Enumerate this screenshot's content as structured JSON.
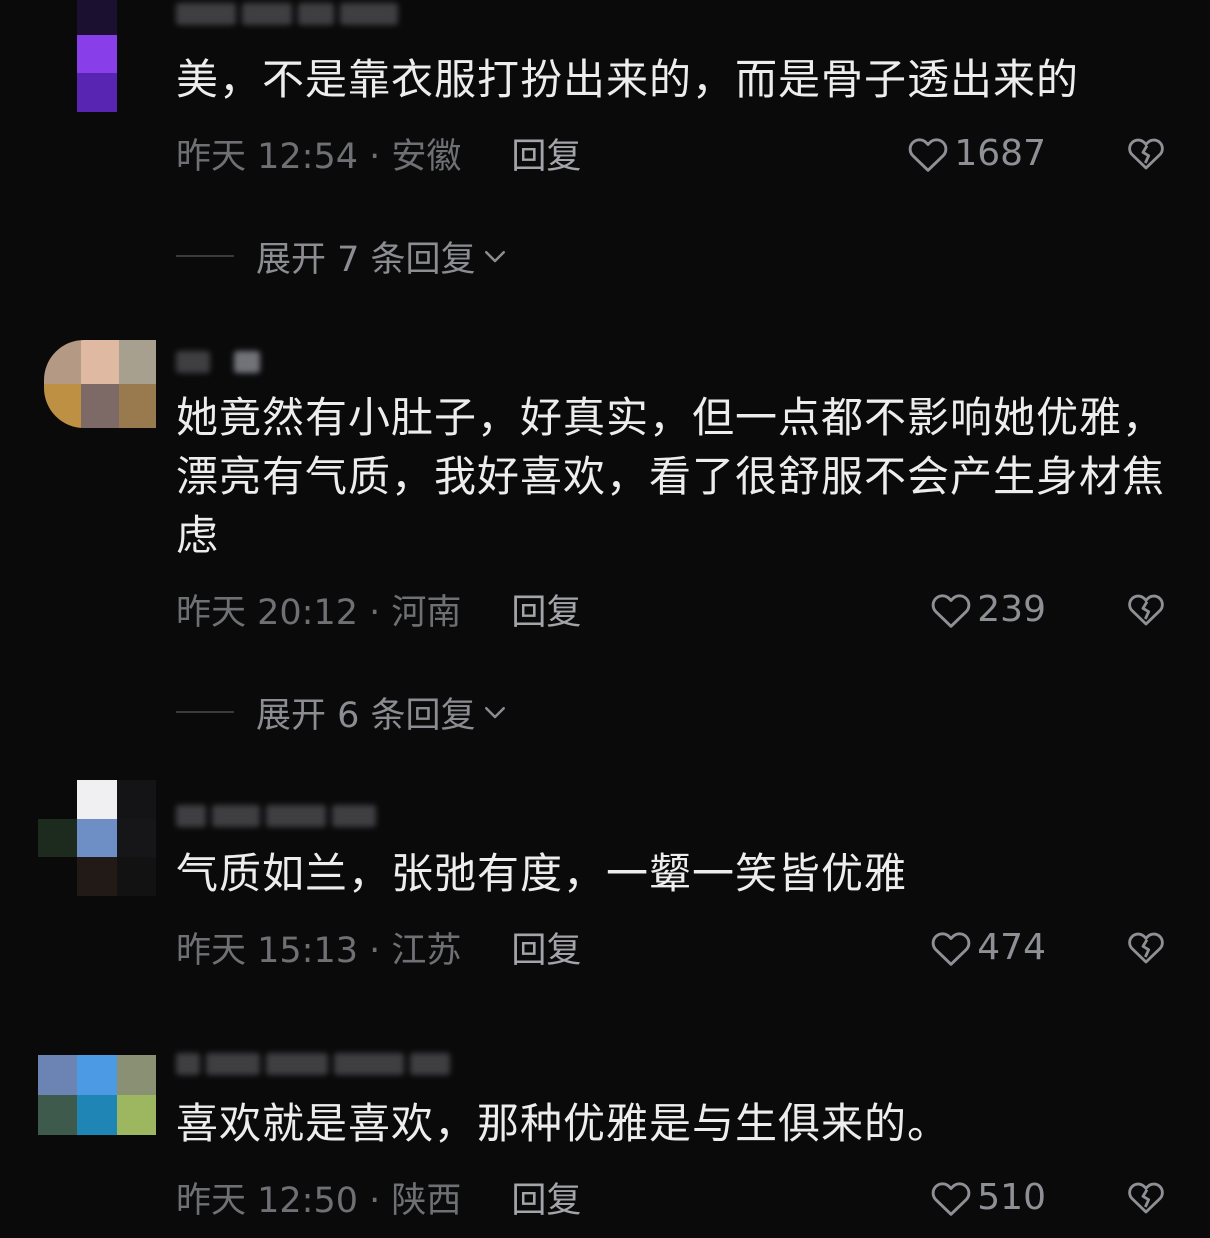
{
  "comments": [
    {
      "text": "美，不是靠衣服打扮出来的，而是骨子透出来的",
      "time": "昨天 12:54 · 安徽",
      "reply": "回复",
      "likes": "1687",
      "expand": "展开 7 条回复"
    },
    {
      "text": "她竟然有小肚子，好真实，但一点都不影响她优雅，漂亮有气质，我好喜欢，看了很舒服不会产生身材焦虑",
      "time": "昨天 20:12 · 河南",
      "reply": "回复",
      "likes": "239",
      "expand": "展开 6 条回复"
    },
    {
      "text": "气质如兰，张弛有度，一颦一笑皆优雅",
      "time": "昨天 15:13 · 江苏",
      "reply": "回复",
      "likes": "474"
    },
    {
      "text": "喜欢就是喜欢，那种优雅是与生俱来的。",
      "time": "昨天 12:50 · 陕西",
      "reply": "回复",
      "likes": "510"
    }
  ],
  "icons": {
    "like": "heart-outline-icon",
    "dislike": "broken-heart-icon",
    "expand": "chevron-down-icon"
  },
  "colors": {
    "background": "#0a0a0b",
    "text": "#ededee",
    "meta": "#6f7074",
    "reply": "#a4a5aa"
  }
}
